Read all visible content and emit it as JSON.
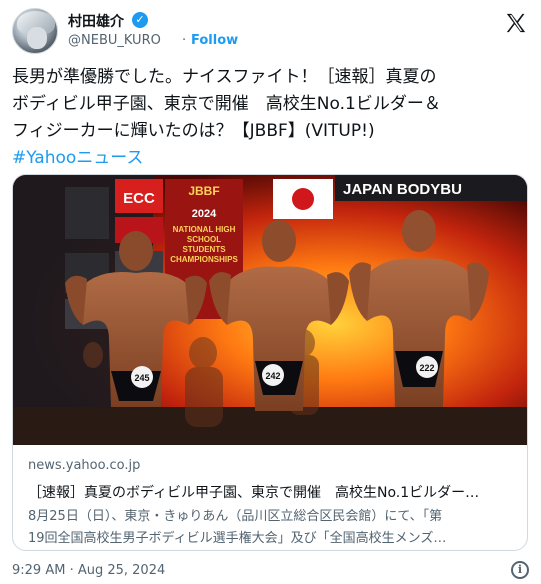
{
  "header": {
    "user_name": "村田雄介",
    "handle": "@NEBU_KURO",
    "dot": "·",
    "follow_label": "Follow",
    "verified_icon": "verified-badge-icon",
    "logo_icon": "x-logo-icon"
  },
  "tweet": {
    "lines": [
      "長男が準優勝でした。ナイスファイト！［速報］真夏の",
      "ボディビル甲子園、東京で開催　高校生No.1ビルダー＆",
      "フィジーカーに輝いたのは？【JBBF】(VITUP!)"
    ],
    "hashtag": "#Yahooニュース"
  },
  "card": {
    "image_signs": {
      "japan_banner": "JAPAN BODYBU",
      "ecc": "ECC",
      "jbbf": "JBBF",
      "jbbf_year": "2024",
      "championship": "NATIONAL HIGH SCHOOL STUDENTS CHAMPIONSHIPS",
      "competitors": [
        "245",
        "242",
        "222"
      ]
    },
    "domain": "news.yahoo.co.jp",
    "title": "［速報］真夏のボディビル甲子園、東京で開催　高校生No.1ビルダー…",
    "desc_lines": [
      "8月25日（日）、東京・きゅりあん（品川区立総合区民会館）にて、「第",
      "19回全国高校生男子ボディビル選手権大会」及び「全国高校生メンズ…"
    ]
  },
  "footer": {
    "timestamp": "9:29 AM · Aug 25, 2024",
    "info_icon": "info-icon"
  },
  "colors": {
    "accent": "#1d9bf0",
    "text": "#0f1419",
    "muted": "#536471",
    "border": "#cfd9de"
  }
}
